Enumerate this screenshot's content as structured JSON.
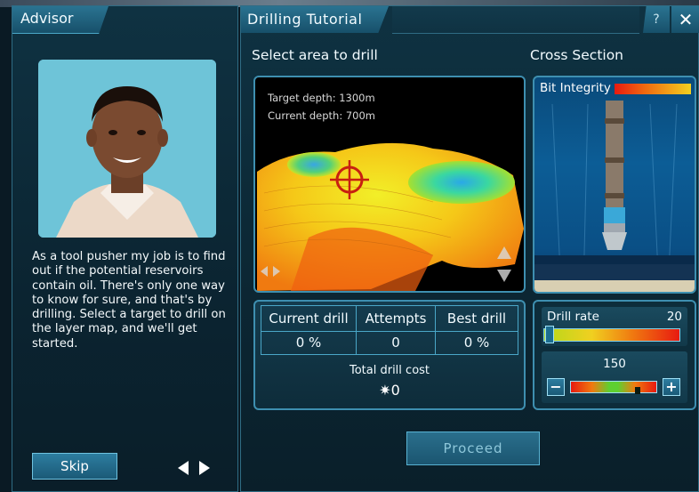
{
  "advisor": {
    "tab_label": "Advisor",
    "message": "As a tool pusher my job is to find out if the potential reservoirs contain oil. There's only one way to know for sure, and that's by drilling. Select a target to drill on the layer map, and we'll get started.",
    "skip_label": "Skip"
  },
  "tutorial": {
    "tab_label": "Drilling Tutorial",
    "help_label": "?",
    "close_label": "✕",
    "select_area_title": "Select area to drill",
    "cross_section_title": "Cross Section",
    "target_depth": "Target depth: 1300m",
    "current_depth": "Current depth: 700m",
    "stats": {
      "headers": [
        "Current drill",
        "Attempts",
        "Best drill"
      ],
      "values": [
        "0 %",
        "0",
        "0 %"
      ]
    },
    "total_drill_cost_label": "Total drill cost",
    "total_drill_cost_value": "✷0",
    "bit_integrity_label": "Bit Integrity",
    "bit_integrity_level": 1.0,
    "drill_rate_label": "Drill rate",
    "drill_rate_value": "20",
    "drill_rate_slider_level": 0.02,
    "stepper_value": "150",
    "stepper_minus": "−",
    "stepper_plus": "+",
    "proceed_label": "Proceed"
  }
}
